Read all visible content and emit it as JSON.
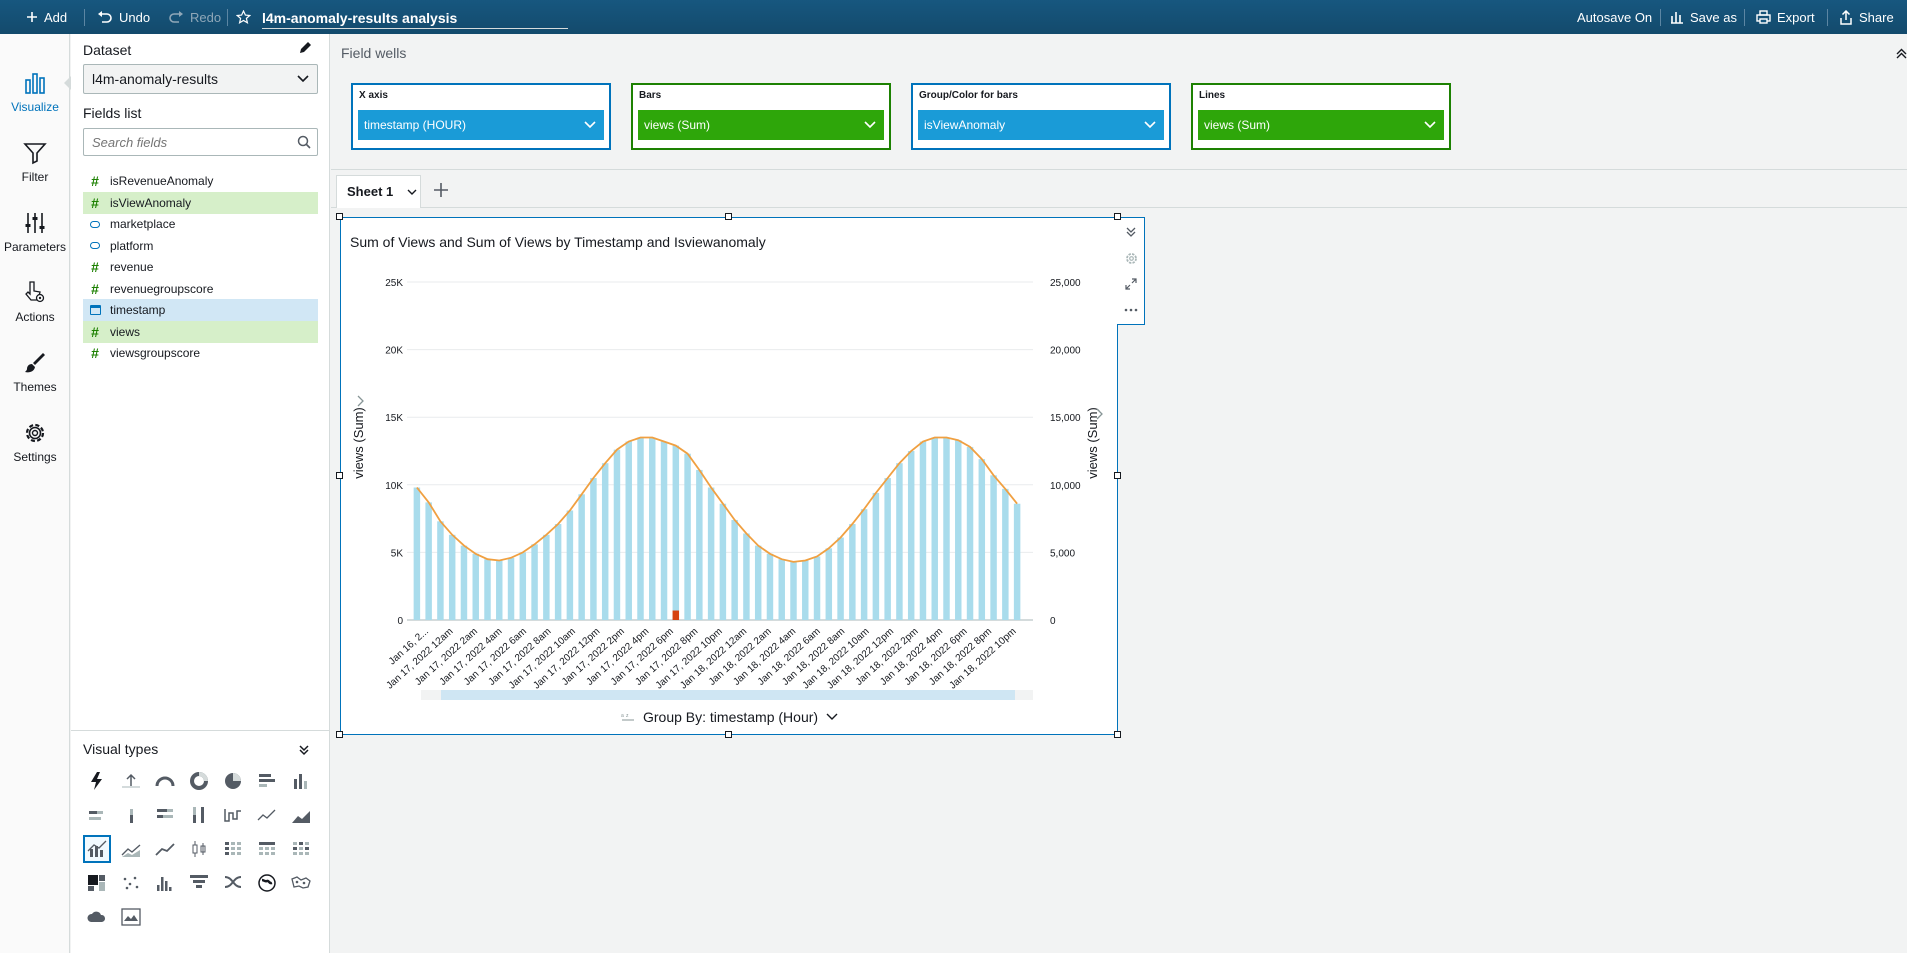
{
  "topbar": {
    "add_label": "Add",
    "undo_label": "Undo",
    "redo_label": "Redo",
    "analysis_name": "l4m-anomaly-results analysis",
    "autosave_label": "Autosave On",
    "save_as_label": "Save as",
    "export_label": "Export",
    "share_label": "Share"
  },
  "rail": {
    "visualize": "Visualize",
    "filter": "Filter",
    "parameters": "Parameters",
    "actions": "Actions",
    "themes": "Themes",
    "settings": "Settings"
  },
  "panel": {
    "dataset_heading": "Dataset",
    "dataset_value": "l4m-anomaly-results",
    "fields_heading": "Fields list",
    "search_placeholder": "Search fields",
    "fields": [
      {
        "name": "isRevenueAnomaly",
        "type": "number",
        "state": "none"
      },
      {
        "name": "isViewAnomaly",
        "type": "number",
        "state": "green"
      },
      {
        "name": "marketplace",
        "type": "string",
        "state": "none"
      },
      {
        "name": "platform",
        "type": "string",
        "state": "none"
      },
      {
        "name": "revenue",
        "type": "number",
        "state": "none"
      },
      {
        "name": "revenuegroupscore",
        "type": "number",
        "state": "none"
      },
      {
        "name": "timestamp",
        "type": "date",
        "state": "blue"
      },
      {
        "name": "views",
        "type": "number",
        "state": "green"
      },
      {
        "name": "viewsgroupscore",
        "type": "number",
        "state": "none"
      }
    ],
    "visual_types_heading": "Visual types"
  },
  "field_wells": {
    "heading": "Field wells",
    "wells": [
      {
        "title": "X axis",
        "value": "timestamp (HOUR)",
        "color": "blue"
      },
      {
        "title": "Bars",
        "value": "views (Sum)",
        "color": "green"
      },
      {
        "title": "Group/Color for bars",
        "value": "isViewAnomaly",
        "color": "blue"
      },
      {
        "title": "Lines",
        "value": "views (Sum)",
        "color": "green"
      }
    ]
  },
  "sheet": {
    "tab_label": "Sheet 1"
  },
  "visual": {
    "title": "Sum of Views and Sum of Views by Timestamp and Isviewanomaly",
    "group_by_label": "Group By: timestamp (Hour)"
  },
  "colors": {
    "bar": "#a9dcec",
    "anomaly_bar": "#d64311",
    "line": "#f0a041",
    "accent": "#0073bb"
  },
  "chart_data": {
    "type": "bar",
    "title": "Sum of Views and Sum of Views by Timestamp and Isviewanomaly",
    "ylabel": "views (Sum)",
    "y2label": "views (Sum)",
    "ylim": [
      0,
      25000
    ],
    "yticks_left": [
      "0",
      "5K",
      "10K",
      "15K",
      "20K",
      "25K"
    ],
    "yticks_right": [
      "0",
      "5,000",
      "10,000",
      "15,000",
      "20,000",
      "25,000"
    ],
    "grid": true,
    "x_tick_labels": [
      "Jan 16, 2...",
      "Jan 17, 2022 12am",
      "Jan 17, 2022 2am",
      "Jan 17, 2022 4am",
      "Jan 17, 2022 6am",
      "Jan 17, 2022 8am",
      "Jan 17, 2022 10am",
      "Jan 17, 2022 12pm",
      "Jan 17, 2022 2pm",
      "Jan 17, 2022 4pm",
      "Jan 17, 2022 6pm",
      "Jan 17, 2022 8pm",
      "Jan 17, 2022 10pm",
      "Jan 18, 2022 12am",
      "Jan 18, 2022 2am",
      "Jan 18, 2022 4am",
      "Jan 18, 2022 6am",
      "Jan 18, 2022 8am",
      "Jan 18, 2022 10am",
      "Jan 18, 2022 12pm",
      "Jan 18, 2022 2pm",
      "Jan 18, 2022 4pm",
      "Jan 18, 2022 6pm",
      "Jan 18, 2022 8pm",
      "Jan 18, 2022 10pm"
    ],
    "series": [
      {
        "name": "isViewAnomaly = 0",
        "type": "bar",
        "values": [
          9800,
          8700,
          7300,
          6300,
          5500,
          4900,
          4500,
          4400,
          4600,
          5000,
          5600,
          6300,
          7100,
          8100,
          9300,
          10500,
          11600,
          12600,
          13200,
          13500,
          13500,
          13200,
          12900,
          12300,
          11100,
          9800,
          8600,
          7400,
          6400,
          5500,
          4900,
          4500,
          4300,
          4400,
          4700,
          5300,
          6100,
          7100,
          8200,
          9400,
          10500,
          11600,
          12500,
          13200,
          13500,
          13500,
          13300,
          12800,
          11900,
          10700,
          9700,
          8600
        ]
      },
      {
        "name": "isViewAnomaly = 1",
        "type": "bar",
        "values": [
          0,
          0,
          0,
          0,
          0,
          0,
          0,
          0,
          0,
          0,
          0,
          0,
          0,
          0,
          0,
          0,
          0,
          0,
          0,
          0,
          0,
          0,
          700,
          0,
          0,
          0,
          0,
          0,
          0,
          0,
          0,
          0,
          0,
          0,
          0,
          0,
          0,
          0,
          0,
          0,
          0,
          0,
          0,
          0,
          0,
          0,
          0,
          0,
          0,
          0,
          0,
          0
        ]
      },
      {
        "name": "views (Sum)",
        "type": "line",
        "values": [
          9800,
          8700,
          7300,
          6300,
          5500,
          4900,
          4500,
          4400,
          4600,
          5000,
          5600,
          6300,
          7100,
          8100,
          9300,
          10500,
          11600,
          12600,
          13200,
          13500,
          13500,
          13200,
          12900,
          12300,
          11100,
          9800,
          8600,
          7400,
          6400,
          5500,
          4900,
          4500,
          4300,
          4400,
          4700,
          5300,
          6100,
          7100,
          8200,
          9400,
          10500,
          11600,
          12500,
          13200,
          13500,
          13500,
          13300,
          12800,
          11900,
          10700,
          9700,
          8600
        ]
      }
    ]
  }
}
